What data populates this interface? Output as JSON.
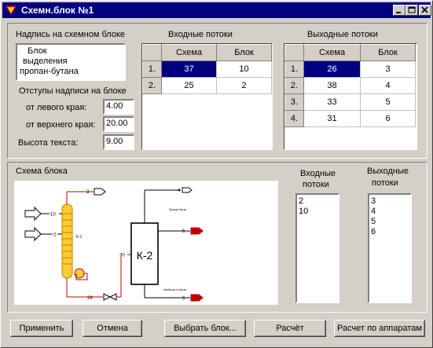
{
  "window": {
    "title": "Схемн.блок №1"
  },
  "label_group": {
    "caption": "Надпись на схемном блоке",
    "lines": [
      "Блок",
      "выделения",
      "пропан-бутана"
    ]
  },
  "offsets": {
    "caption": "Отступы надписи на блоке",
    "left_label": "от левого края:",
    "left_value": "4.00",
    "top_label": "от верхнего края:",
    "top_value": "20.00",
    "height_label": "Высота текста:",
    "height_value": "9.00"
  },
  "input_flows": {
    "caption": "Входные потоки",
    "headers": [
      "Схема",
      "Блок"
    ],
    "rows": [
      {
        "n": "1.",
        "scheme": "37",
        "block": "10"
      },
      {
        "n": "2.",
        "scheme": "25",
        "block": "2"
      }
    ]
  },
  "output_flows": {
    "caption": "Выходные потоки",
    "headers": [
      "Схема",
      "Блок"
    ],
    "rows": [
      {
        "n": "1.",
        "scheme": "26",
        "block": "3"
      },
      {
        "n": "2.",
        "scheme": "38",
        "block": "4"
      },
      {
        "n": "3.",
        "scheme": "33",
        "block": "5"
      },
      {
        "n": "4.",
        "scheme": "31",
        "block": "6"
      }
    ]
  },
  "scheme": {
    "caption": "Схема блока",
    "k1": "К-1",
    "k2": "К-2",
    "tags": {
      "s3": "3",
      "s4": "4",
      "s10": "10",
      "s2": "2",
      "s5": "5",
      "s6": "6",
      "s29": "29",
      "s30": "30"
    },
    "k2_top_note": "Пропан-бутан",
    "k2_bottom_note": "Изобутан+н.бутан"
  },
  "block_inputs": {
    "caption_1": "Входные",
    "caption_2": "потоки",
    "items": [
      "2",
      "10"
    ]
  },
  "block_outputs": {
    "caption_1": "Выходные",
    "caption_2": "потоки",
    "items": [
      "3",
      "4",
      "5",
      "6"
    ]
  },
  "buttons": {
    "apply": "Применить",
    "cancel": "Отмена",
    "choose_block": "Выбрать блок...",
    "calculate": "Расчёт",
    "calc_by_units": "Расчет по аппаратам"
  }
}
